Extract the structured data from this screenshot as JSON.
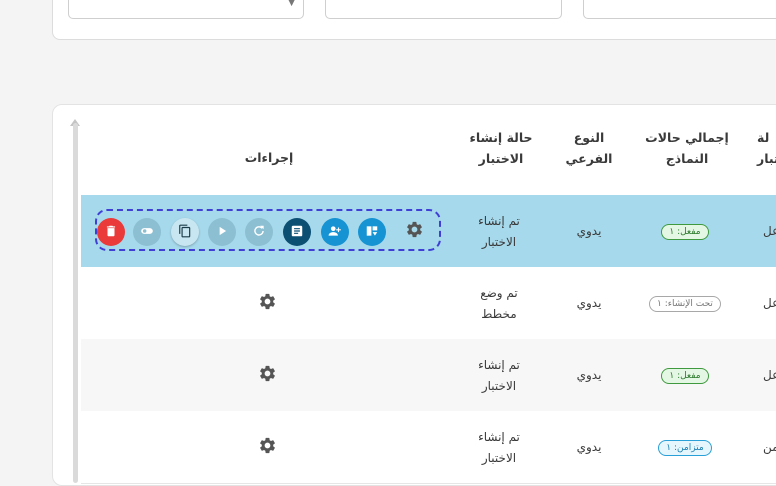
{
  "table": {
    "headers": {
      "actions": "إجراءات",
      "status_line1": "حالة إنشاء",
      "status_line2": "الاختبار",
      "subtype_line1": "النوع",
      "subtype_line2": "الفرعي",
      "total_line1": "إجمالي حالات",
      "total_line2": "النماذج",
      "edge_line1": "لة",
      "edge_line2": "تبار"
    },
    "rows": [
      {
        "status_line1": "تم إنشاء",
        "status_line2": "الاختبار",
        "subtype": "يدوي",
        "badge": "مفعل: ١",
        "edge": "عل"
      },
      {
        "status_line1": "تم وضع",
        "status_line2": "مخطط",
        "subtype": "يدوي",
        "badge": "تحت الإنشاء: ١",
        "edge": "عل"
      },
      {
        "status_line1": "تم إنشاء",
        "status_line2": "الاختبار",
        "subtype": "يدوي",
        "badge": "مفعل: ١",
        "edge": "عل"
      },
      {
        "status_line1": "تم إنشاء",
        "status_line2": "الاختبار",
        "subtype": "يدوي",
        "badge": "متزامن: ١",
        "edge": "من"
      }
    ]
  },
  "colors": {
    "selected_row": "#a6d9ec",
    "toolbar_outline": "#3f3fd6",
    "delete": "#ea3a3a",
    "primary_dark": "#0b4f73",
    "primary": "#1693d2",
    "badge_green": "#3f9a3f",
    "badge_blue": "#2aa0d8"
  },
  "icons": [
    "trash-icon",
    "toggle-icon",
    "copy-icon",
    "play-icon",
    "refresh-icon",
    "document-icon",
    "assign-users-icon",
    "layout-icon",
    "gear-icon",
    "chevron-down-icon"
  ]
}
